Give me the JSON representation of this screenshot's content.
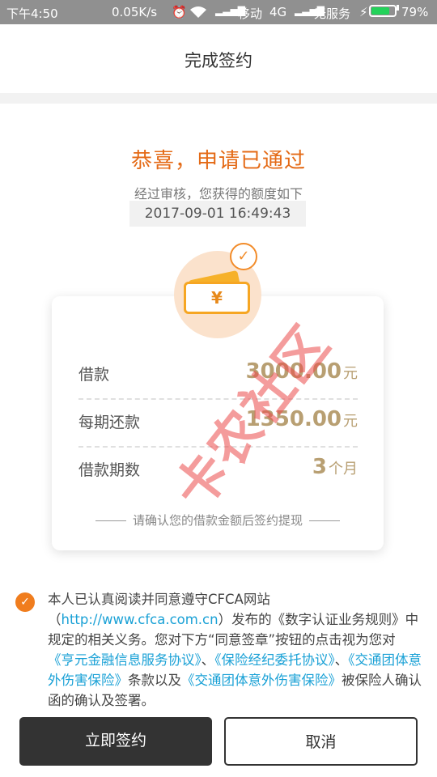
{
  "status_bar": {
    "time": "下午4:50",
    "speed": "0.05K/s",
    "carrier1": "移动",
    "network": "4G",
    "carrier2": "无服务",
    "battery": "79%",
    "battery_level": 0.79
  },
  "header": {
    "title": "完成签约"
  },
  "result": {
    "title": "恭喜，申请已通过",
    "subtitle": "经过审核，您获得的额度如下",
    "timestamp": "2017-09-01 16:49:43"
  },
  "badge": {
    "symbol": "¥",
    "icon": "ticket-icon",
    "check_icon": "check-circle-icon"
  },
  "loan": {
    "rows": [
      {
        "label": "借款",
        "value": "3000.00",
        "unit": "元"
      },
      {
        "label": "每期还款",
        "value": "1350.00",
        "unit": "元"
      },
      {
        "label": "借款期数",
        "value": "3",
        "unit": "个月"
      }
    ],
    "footer": "请确认您的借款金额后签约提现"
  },
  "watermark": "卡农社区",
  "agreement": {
    "checked": true,
    "t1": "本人已认真阅读并同意遵守CFCA网站（",
    "link_site": "http://www.cfca.com.cn",
    "t2": "）发布的《数字认证业务规则》中规定的相关义务。您对下方“同意签章”按钮的点击视为您对",
    "link1": "《亨元金融信息服务协议》",
    "sep1": "、",
    "link2": "《保险经纪委托协议》",
    "sep2": "、",
    "link3": "《交通团体意外伤害保险》",
    "t3": "条款以及",
    "link4": "《交通团体意外伤害保险》",
    "t4": "被保险人确认函的确认及签署。"
  },
  "buttons": {
    "sign": "立即签约",
    "cancel": "取消"
  },
  "colors": {
    "accent": "#e46a16",
    "amount": "#b89f72",
    "link": "#1aa1d6",
    "dark_button": "#333333"
  }
}
